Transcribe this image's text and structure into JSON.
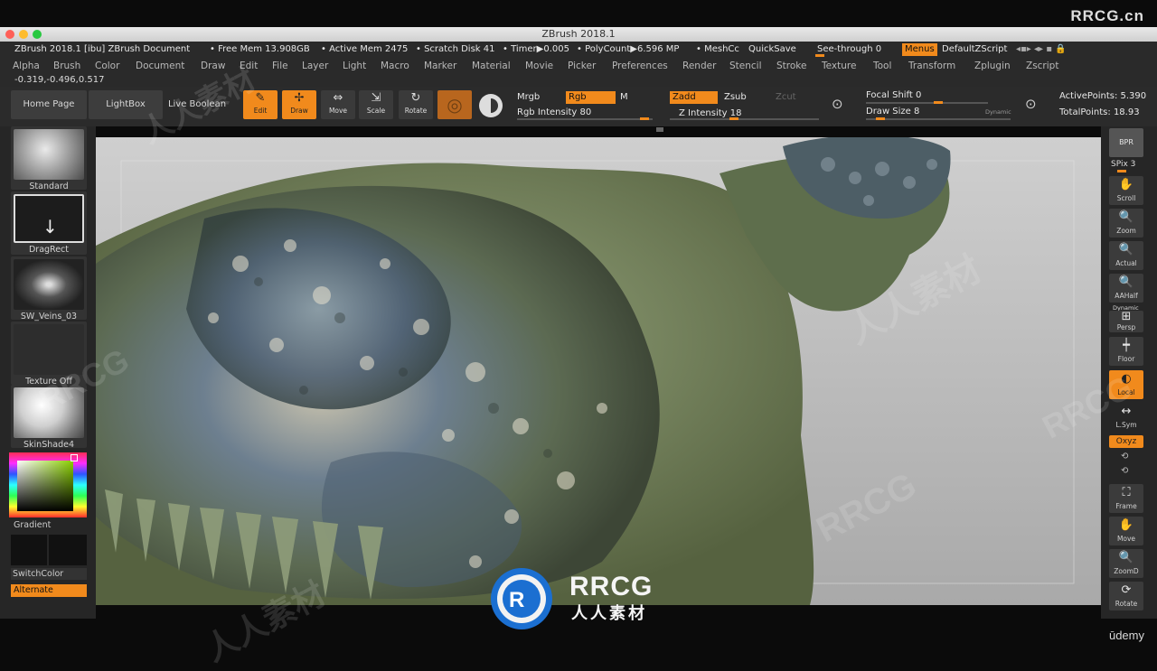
{
  "window": {
    "title": "ZBrush 2018.1",
    "corner_watermark": "RRCG.cn"
  },
  "infobar": {
    "doc": "ZBrush 2018.1 [ibu] ZBrush Document",
    "free_mem": "• Free Mem 13.908GB",
    "active_mem": "• Active Mem 2475",
    "scratch": "• Scratch Disk 41",
    "timer": "• Timer▶0.005",
    "polycount": "• PolyCount▶6.596 MP",
    "meshcount": "• MeshCc",
    "quicksave": "QuickSave",
    "see_through": "See-through  0",
    "menus": "Menus",
    "default_zscript": "DefaultZScript"
  },
  "menus": [
    "Alpha",
    "Brush",
    "Color",
    "Document",
    "Draw",
    "Edit",
    "File",
    "Layer",
    "Light",
    "Macro",
    "Marker",
    "Material",
    "Movie",
    "Picker",
    "Preferences",
    "Render",
    "Stencil",
    "Stroke",
    "Texture",
    "Tool",
    "Transform",
    "Zplugin",
    "Zscript"
  ],
  "coords": "-0.319,-0.496,0.517",
  "shelf": {
    "home_page": "Home Page",
    "lightbox": "LightBox",
    "live_boolean": "Live Boolean",
    "tools": [
      {
        "label": "Edit",
        "glyph": "✎"
      },
      {
        "label": "Draw",
        "glyph": "✢"
      },
      {
        "label": "Move",
        "glyph": "⇔"
      },
      {
        "label": "Scale",
        "glyph": "⇲"
      },
      {
        "label": "Rotate",
        "glyph": "↻"
      }
    ],
    "mrgb": "Mrgb",
    "rgb": "Rgb",
    "m": "M",
    "rgb_intensity": "Rgb Intensity 80",
    "zadd": "Zadd",
    "zsub": "Zsub",
    "zcut": "Zcut",
    "z_intensity": "Z Intensity 18",
    "focal_shift": "Focal Shift 0",
    "draw_size": "Draw Size 8",
    "dynamic": "Dynamic",
    "active_points": "ActivePoints: 5.390",
    "total_points": "TotalPoints: 18.93"
  },
  "left": {
    "brush": "Standard",
    "stroke": "DragRect",
    "alpha": "SW_Veins_03",
    "texture": "Texture Off",
    "material": "SkinShade4",
    "gradient": "Gradient",
    "switch_color": "SwitchColor",
    "alternate": "Alternate"
  },
  "right": [
    {
      "label": "BPR",
      "glyph": "",
      "name": "bpr-button"
    },
    {
      "label": "SPix 3",
      "glyph": "",
      "name": "spix-slider"
    },
    {
      "label": "Scroll",
      "glyph": "✋",
      "name": "scroll-button"
    },
    {
      "label": "Zoom",
      "glyph": "🔍",
      "name": "zoom-button"
    },
    {
      "label": "Actual",
      "glyph": "🔍",
      "name": "actual-button"
    },
    {
      "label": "AAHalf",
      "glyph": "🔍",
      "name": "aahalf-button"
    },
    {
      "label": "Persp",
      "glyph": "⊞",
      "name": "persp-button",
      "top_label": "Dynamic"
    },
    {
      "label": "Floor",
      "glyph": "┿",
      "name": "floor-button"
    },
    {
      "label": "Local",
      "glyph": "◐",
      "name": "local-button"
    },
    {
      "label": "L.Sym",
      "glyph": "↔",
      "name": "lsym-button"
    },
    {
      "label": "Oxyz",
      "glyph": "",
      "name": "xyz-button"
    },
    {
      "label": "Frame",
      "glyph": "⛶",
      "name": "frame-button"
    },
    {
      "label": "Move",
      "glyph": "✋",
      "name": "move-button"
    },
    {
      "label": "ZoomD",
      "glyph": "🔍",
      "name": "zoomd-button"
    },
    {
      "label": "Rotate",
      "glyph": "⟳",
      "name": "rotate-button"
    }
  ],
  "overlay": {
    "logo_text": "RRCG",
    "logo_sub": "人人素材",
    "watermark_cn": "人人素材",
    "watermark_en": "RRCG",
    "udemy": "ūdemy"
  },
  "colors": {
    "accent": "#f18a1c",
    "panel": "#262626",
    "shelf": "#2b2b2b"
  }
}
